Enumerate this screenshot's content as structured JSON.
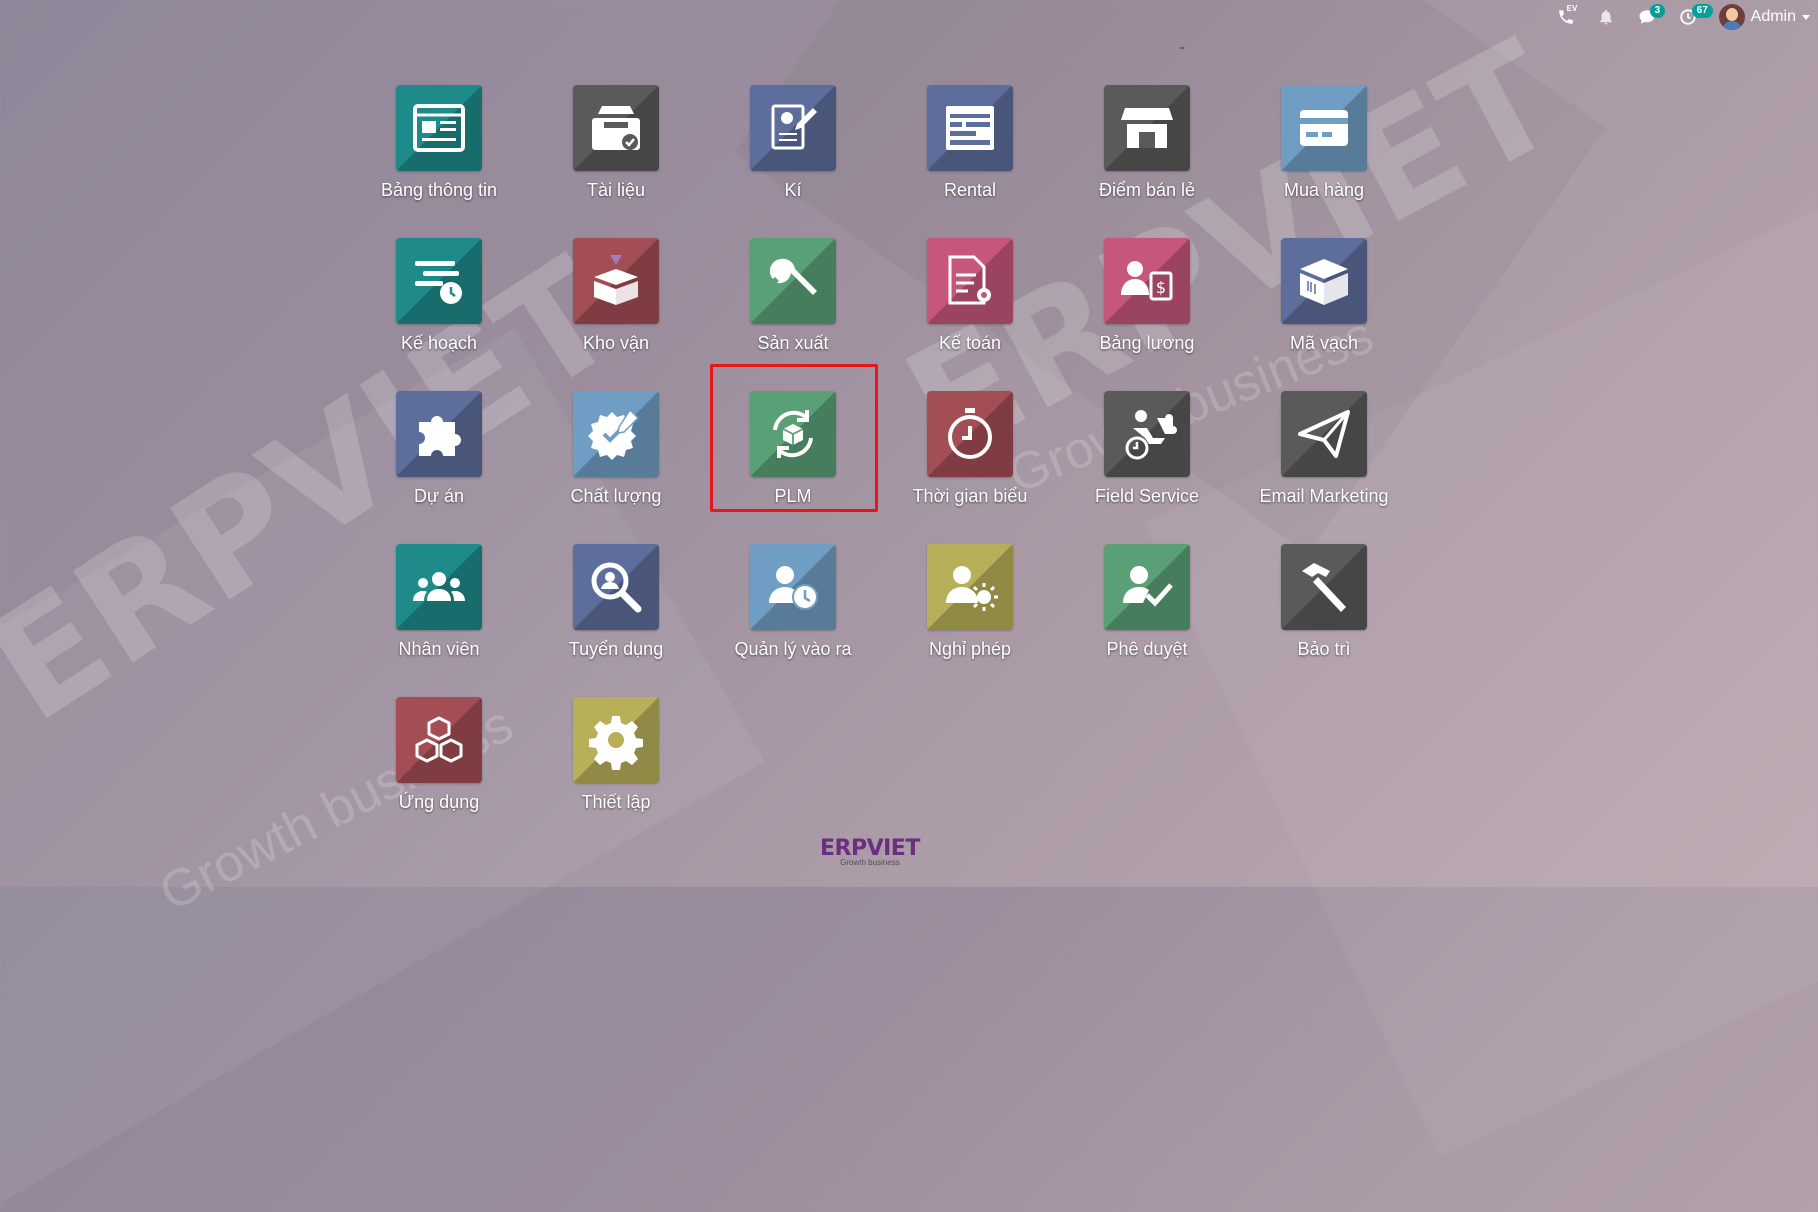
{
  "topbar": {
    "phone_label": "EV",
    "messages_count": "3",
    "activities_count": "67",
    "user_name": "Admin"
  },
  "watermark": {
    "brand": "ERPVIET",
    "tagline": "Growth business"
  },
  "apps": [
    {
      "label": "Bảng thông tin",
      "icon": "dashboard-icon",
      "color": "#1e8a8a"
    },
    {
      "label": "Tài liệu",
      "icon": "documents-icon",
      "color": "#5a5a5a"
    },
    {
      "label": "Kí",
      "icon": "sign-icon",
      "color": "#5d6e9c"
    },
    {
      "label": "Rental",
      "icon": "rental-icon",
      "color": "#5d6e9c"
    },
    {
      "label": "Điểm bán lẻ",
      "icon": "shop-icon",
      "color": "#5a5a5a"
    },
    {
      "label": "Mua hàng",
      "icon": "purchase-card-icon",
      "color": "#6f9dc3"
    },
    {
      "label": "Kế hoạch",
      "icon": "planning-icon",
      "color": "#1e8a8a"
    },
    {
      "label": "Kho vận",
      "icon": "inventory-box-icon",
      "color": "#a34d54"
    },
    {
      "label": "Sản xuất",
      "icon": "wrench-icon",
      "color": "#5aa077"
    },
    {
      "label": "Kế toán",
      "icon": "accounting-icon",
      "color": "#c6577a"
    },
    {
      "label": "Bảng lương",
      "icon": "payroll-icon",
      "color": "#c6577a"
    },
    {
      "label": "Mã vạch",
      "icon": "barcode-box-icon",
      "color": "#5d6e9c"
    },
    {
      "label": "Dự án",
      "icon": "puzzle-icon",
      "color": "#5d6e9c"
    },
    {
      "label": "Chất lượng",
      "icon": "quality-badge-icon",
      "color": "#6f9dc3"
    },
    {
      "label": "PLM",
      "icon": "plm-cycle-icon",
      "color": "#5aa077"
    },
    {
      "label": "Thời gian biểu",
      "icon": "stopwatch-icon",
      "color": "#a34d54"
    },
    {
      "label": "Field Service",
      "icon": "field-service-icon",
      "color": "#5a5a5a"
    },
    {
      "label": "Email Marketing",
      "icon": "paper-plane-icon",
      "color": "#5a5a5a"
    },
    {
      "label": "Nhân viên",
      "icon": "employees-icon",
      "color": "#1e8a8a"
    },
    {
      "label": "Tuyển dụng",
      "icon": "recruitment-search-icon",
      "color": "#5d6e9c"
    },
    {
      "label": "Quản lý vào ra",
      "icon": "attendance-icon",
      "color": "#6f9dc3"
    },
    {
      "label": "Nghỉ phép",
      "icon": "time-off-icon",
      "color": "#b8b058"
    },
    {
      "label": "Phê duyệt",
      "icon": "approval-icon",
      "color": "#5aa077"
    },
    {
      "label": "Bảo trì",
      "icon": "hammer-icon",
      "color": "#5a5a5a"
    },
    {
      "label": "Ứng dụng",
      "icon": "apps-cubes-icon",
      "color": "#a34d54"
    },
    {
      "label": "Thiết lập",
      "icon": "settings-gear-icon",
      "color": "#b8b058"
    }
  ],
  "highlighted_app": "PLM",
  "footer": {
    "brand_a": "ERP",
    "brand_b": "VIET",
    "tagline": "Growth business"
  }
}
